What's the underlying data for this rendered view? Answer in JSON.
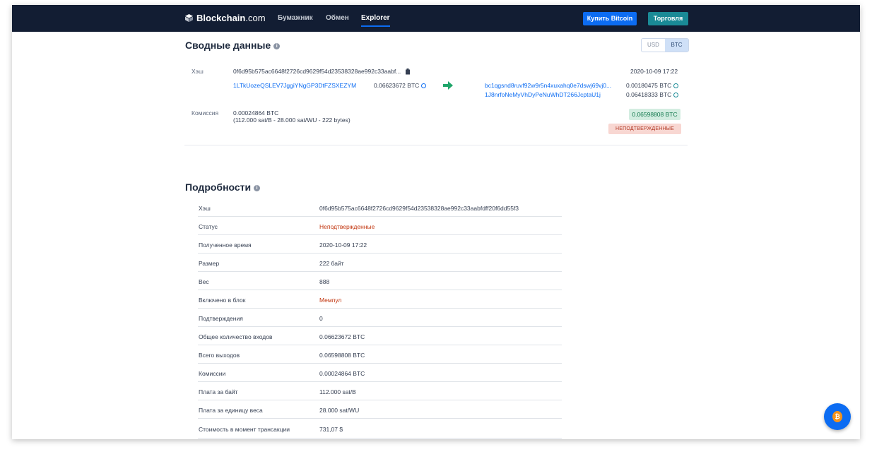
{
  "nav": {
    "logo_main": "Blockchain",
    "logo_suffix": ".com",
    "links": [
      "Бумажник",
      "Обмен",
      "Explorer"
    ],
    "buy_button": "Купить Bitcoin",
    "trade_button": "Торговля"
  },
  "summary": {
    "title": "Сводные данные",
    "currency_options": [
      "USD",
      "BTC"
    ],
    "selected_currency": "BTC",
    "hash_label": "Хэш",
    "hash_value": "0f6d95b575ac6648f2726cd9629f54d23538328ae992c33aabf...",
    "timestamp": "2020-10-09 17:22",
    "input_address": "1LTkUozeQSLEV7JggiYNgGP3DtFZSXEZYM",
    "input_amount": "0.06623672 BTC",
    "outputs": [
      {
        "address": "bc1qgsnd8ruvf92w9r5n4xuxahq0e7dswj69vj0...",
        "amount": "0.00180475 BTC"
      },
      {
        "address": "1J8nrfoNeMyVhDyPeNuWhDT266JcptaU1j",
        "amount": "0.06418333 BTC"
      }
    ],
    "fee_label": "Комиссия",
    "fee_value": "0.00024864 BTC",
    "fee_detail": "(112.000 sat/B - 28.000 sat/WU - 222 bytes)",
    "total_amount": "0.06598808 BTC",
    "status_badge": "НЕПОДТВЕРЖДЕННЫЕ"
  },
  "details": {
    "title": "Подробности",
    "rows": [
      {
        "key": "Хэш",
        "value": "0f6d95b575ac6648f2726cd9629f54d23538328ae992c33aabfdff20f6dd55f3"
      },
      {
        "key": "Статус",
        "value": "Неподтвержденные"
      },
      {
        "key": "Полученное время",
        "value": "2020-10-09 17:22"
      },
      {
        "key": "Размер",
        "value": "222 байт"
      },
      {
        "key": "Вес",
        "value": "888"
      },
      {
        "key": "Включено в блок",
        "value": "Мемпул"
      },
      {
        "key": "Подтверждения",
        "value": "0"
      },
      {
        "key": "Общее количество входов",
        "value": "0.06623672 BTC"
      },
      {
        "key": "Всего выходов",
        "value": "0.06598808 BTC"
      },
      {
        "key": "Комиссии",
        "value": "0.00024864 BTC"
      },
      {
        "key": "Плата за байт",
        "value": "112.000 sat/B"
      },
      {
        "key": "Плата за единицу веса",
        "value": "28.000 sat/WU"
      },
      {
        "key": "Стоимость в момент трансакции",
        "value": "731,07 $"
      }
    ]
  },
  "fab": {
    "symbol": "₿"
  },
  "colors": {
    "nav_bg": "#121d33",
    "accent": "#0c6cf2",
    "trade": "#1a8a96",
    "error": "#c2360f",
    "success_bg": "#d3ede1"
  }
}
